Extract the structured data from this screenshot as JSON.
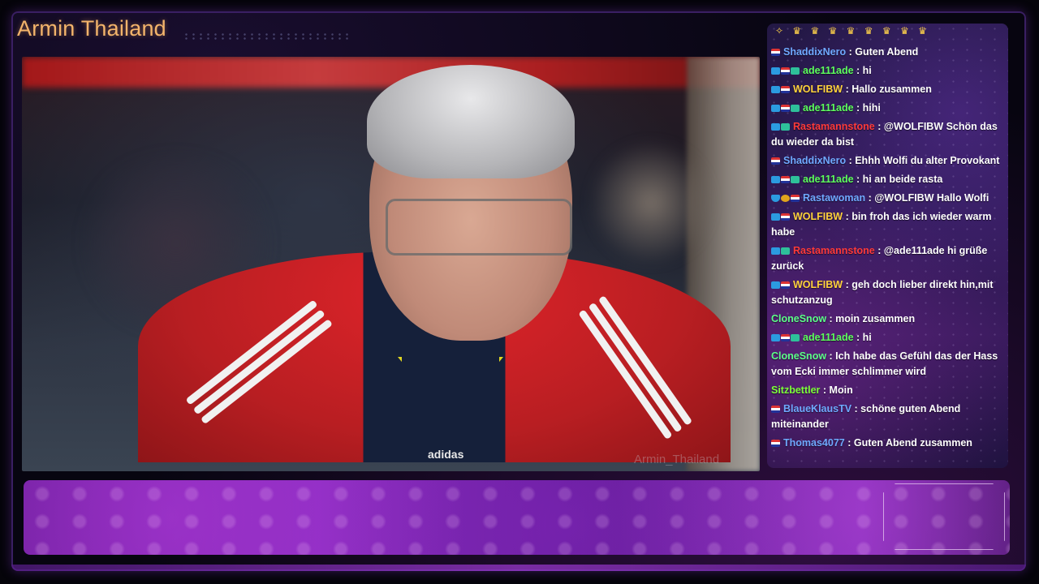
{
  "stream": {
    "title": "Armin Thailand",
    "video_watermark": "Armin_Thailand",
    "video_shirt_brand": "adidas"
  },
  "chat": {
    "top_badges": "✧ ♛ ♛ ♛ ♛ ♛ ♛ ♛ ♛",
    "messages": [
      {
        "user": "ShaddixNero",
        "color": "#6fa9ff",
        "badges": [
          "flag"
        ],
        "text": "Guten Abend"
      },
      {
        "user": "ade111ade",
        "color": "#5dff5d",
        "badges": [
          "sub",
          "flag",
          "game"
        ],
        "text": "hi"
      },
      {
        "user": "WOLFIBW",
        "color": "#ffd23c",
        "badges": [
          "sub",
          "flag"
        ],
        "text": "Hallo zusammen"
      },
      {
        "user": "ade111ade",
        "color": "#5dff5d",
        "badges": [
          "sub",
          "flag",
          "game"
        ],
        "text": "hihi"
      },
      {
        "user": "Rastamannstone",
        "color": "#ff3a3a",
        "badges": [
          "sub",
          "game"
        ],
        "text": "@WOLFIBW Schön das du wieder da bist"
      },
      {
        "user": "ShaddixNero",
        "color": "#6fa9ff",
        "badges": [
          "flag"
        ],
        "text": "Ehhh Wolfi du alter Provokant"
      },
      {
        "user": "ade111ade",
        "color": "#5dff5d",
        "badges": [
          "sub",
          "flag",
          "game"
        ],
        "text": "hi an beide rasta"
      },
      {
        "user": "Rastawoman",
        "color": "#6fa9ff",
        "badges": [
          "shield",
          "coin",
          "flag"
        ],
        "text": "@WOLFIBW Hallo Wolfi"
      },
      {
        "user": "WOLFIBW",
        "color": "#ffd23c",
        "badges": [
          "sub",
          "flag"
        ],
        "text": "bin froh das ich wieder warm habe"
      },
      {
        "user": "Rastamannstone",
        "color": "#ff3a3a",
        "badges": [
          "sub",
          "game"
        ],
        "text": "@ade111ade hi grüße zurück"
      },
      {
        "user": "WOLFIBW",
        "color": "#ffd23c",
        "badges": [
          "sub",
          "flag"
        ],
        "text": "geh doch lieber direkt hin,mit schutzanzug"
      },
      {
        "user": "CloneSnow",
        "color": "#5dff8a",
        "badges": [],
        "text": "moin zusammen"
      },
      {
        "user": "ade111ade",
        "color": "#5dff5d",
        "badges": [
          "sub",
          "flag",
          "game"
        ],
        "text": "hi"
      },
      {
        "user": "CloneSnow",
        "color": "#5dff8a",
        "badges": [],
        "text": "Ich habe das Gefühl das der Hass vom Ecki immer schlimmer wird"
      },
      {
        "user": "Sitzbettler",
        "color": "#7dff3a",
        "badges": [],
        "text": "Moin"
      },
      {
        "user": "BlaueKlausTV",
        "color": "#6fa9ff",
        "badges": [
          "flag"
        ],
        "text": "schöne guten Abend miteinander"
      },
      {
        "user": "Thomas4077",
        "color": "#6fa9ff",
        "badges": [
          "flag"
        ],
        "text": "Guten Abend zusammen"
      }
    ]
  }
}
